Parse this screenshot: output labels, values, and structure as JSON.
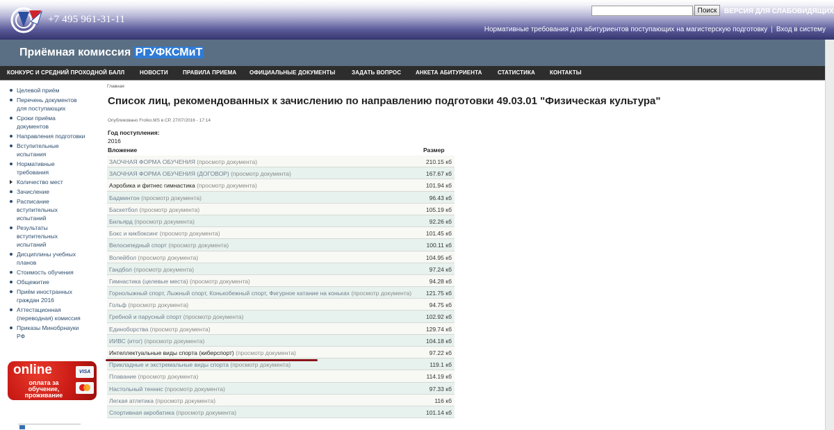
{
  "header": {
    "phone": "+7 495 961-31-11",
    "search_placeholder": "",
    "search_button": "Поиск",
    "vision_link": "ВЕРСИЯ ДЛЯ СЛАБОВИДЯЩИХ",
    "top_links": [
      "Нормативные требования для абитуриентов поступающих на магистерскую подготовку",
      "Вход в систему"
    ]
  },
  "band": {
    "title_prefix": "Приёмная комиссия ",
    "title_highlight": "РГУФКСМиТ"
  },
  "nav": [
    "КОНКУРС И СРЕДНИЙ ПРОХОДНОЙ БАЛЛ",
    "НОВОСТИ",
    "ПРАВИЛА ПРИЕМА",
    "ОФИЦИАЛЬНЫЕ ДОКУМЕНТЫ",
    "ЗАДАТЬ ВОПРОС",
    "АНКЕТА АБИТУРИЕНТА",
    "СТАТИСТИКА",
    "КОНТАКТЫ"
  ],
  "sidebar": [
    {
      "label": "Целевой приём",
      "marker": "dot"
    },
    {
      "label": "Перечень документов для поступающих",
      "marker": "dot"
    },
    {
      "label": "Сроки приёма документов",
      "marker": "dot"
    },
    {
      "label": "Направления подготовки",
      "marker": "dot"
    },
    {
      "label": "Вступительные испытания",
      "marker": "dot"
    },
    {
      "label": "Нормативные требования",
      "marker": "dot"
    },
    {
      "label": "Количество мест",
      "marker": "arrow"
    },
    {
      "label": "Зачисление",
      "marker": "dot"
    },
    {
      "label": "Расписание вступительных испытаний",
      "marker": "dot"
    },
    {
      "label": "Результаты вступительных испытаний",
      "marker": "dot"
    },
    {
      "label": "Дисциплины учебных планов",
      "marker": "dot"
    },
    {
      "label": "Стоимость обучения",
      "marker": "dot"
    },
    {
      "label": "Общежитие",
      "marker": "dot"
    },
    {
      "label": "Приём иностранных граждан 2016",
      "marker": "dot"
    },
    {
      "label": "Аттестационная (переводная) комиссия",
      "marker": "dot"
    },
    {
      "label": "Приказы Минобрнауки РФ",
      "marker": "dot"
    }
  ],
  "banner": {
    "word": "online",
    "sub": "оплата за обучение, проживание",
    "visa": "VISA"
  },
  "content": {
    "breadcrumb": "Главная",
    "title": "Список лиц, рекомендованных к зачислению по направлению подготовки 49.03.01 \"Физическая культура\"",
    "published": "Опубликовано Frolko.MS в СР, 27/07/2016 - 17:14",
    "year_label": "Год поступления:",
    "year_value": "2016",
    "col_attachment": "Вложение",
    "col_size": "Размер",
    "view_text": "(просмотр документа)",
    "rows": [
      {
        "name": "ЗАОЧНАЯ ФОРМА ОБУЧЕНИЯ",
        "view": true,
        "size": "210.15 кб",
        "dark": false
      },
      {
        "name": "ЗАОЧНАЯ ФОРМА ОБУЧЕНИЯ (ДОГОВОР)",
        "view": true,
        "size": "167.67 кб",
        "dark": false
      },
      {
        "name": "Аэробика и фитнес гимнастика",
        "view": true,
        "size": "101.94 кб",
        "dark": true
      },
      {
        "name": "Бадминтон",
        "view": true,
        "size": "96.43 кб",
        "dark": false
      },
      {
        "name": "Баскетбол",
        "view": true,
        "size": "105.19 кб",
        "dark": false
      },
      {
        "name": "Бильярд",
        "view": true,
        "size": "92.26 кб",
        "dark": false
      },
      {
        "name": "Бокс и кикбоксинг",
        "view": true,
        "size": "101.45 кб",
        "dark": false
      },
      {
        "name": "Велосипедный спорт",
        "view": true,
        "size": "100.11 кб",
        "dark": false
      },
      {
        "name": "Волейбол",
        "view": true,
        "size": "104.95 кб",
        "dark": false
      },
      {
        "name": "Гандбол",
        "view": true,
        "size": "97.24 кб",
        "dark": false
      },
      {
        "name": "Гимнастика (целевые места)",
        "view": true,
        "size": "94.28 кб",
        "dark": false
      },
      {
        "name": "Горнолыжный спорт, Лыжный спорт, Конькобежный спорт, Фигурное катание на коньках",
        "view": true,
        "size": "121.75 кб",
        "dark": false
      },
      {
        "name": "Гольф",
        "view": true,
        "size": "94.75 кб",
        "dark": false
      },
      {
        "name": "Гребной и парусный спорт",
        "view": true,
        "size": "102.92 кб",
        "dark": false
      },
      {
        "name": "Единоборства",
        "view": true,
        "size": "129.74 кб",
        "dark": false
      },
      {
        "name": "ИИВС (итог)",
        "view": true,
        "size": "104.18 кб",
        "dark": false
      },
      {
        "name": "Интеллектуальные виды спорта (киберспорт)",
        "view": true,
        "size": "97.22 кб",
        "dark": true
      },
      {
        "name": "Прикладные и экстремальные виды спорта",
        "view": true,
        "size": "119.1 кб",
        "dark": false
      },
      {
        "name": "Плавание",
        "view": true,
        "size": "114.19 кб",
        "dark": false
      },
      {
        "name": "Настольный теннис",
        "view": true,
        "size": "97.33 кб",
        "dark": false
      },
      {
        "name": "Легкая атлетика",
        "view": true,
        "size": "116 кб",
        "dark": false
      },
      {
        "name": "Спортивная акробатика",
        "view": true,
        "size": "101.14 кб",
        "dark": false
      }
    ]
  }
}
